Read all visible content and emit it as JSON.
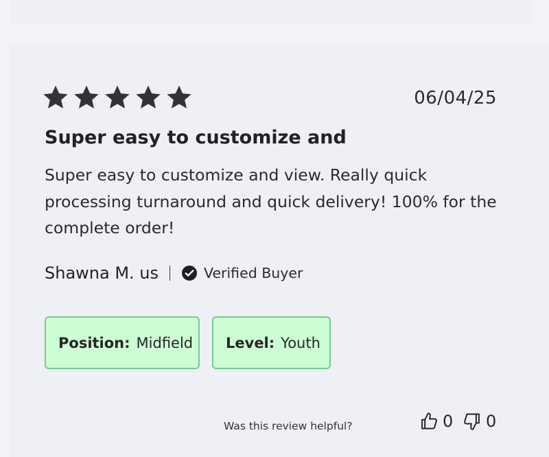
{
  "review": {
    "rating": 5,
    "rating_max": 5,
    "date": "06/04/25",
    "title": "Super easy to customize and",
    "body": "Super easy to customize and view. Really quick processing turnaround and quick delivery! 100% for the complete order!",
    "author": "Shawna M. us",
    "verified_label": "Verified Buyer",
    "tags": [
      {
        "key": "Position:",
        "value": "Midfield"
      },
      {
        "key": "Level:",
        "value": "Youth"
      }
    ]
  },
  "helpful": {
    "prompt": "Was this review helpful?",
    "up_count": "0",
    "down_count": "0"
  },
  "icons": {
    "star": "star-icon",
    "verified": "check-circle-icon",
    "thumbs_up": "thumbs-up-icon",
    "thumbs_down": "thumbs-down-icon"
  },
  "colors": {
    "star": "#333333",
    "tag_bg": "#ccfdd3",
    "tag_border": "#79c990",
    "card_bg": "#eff0f5"
  }
}
